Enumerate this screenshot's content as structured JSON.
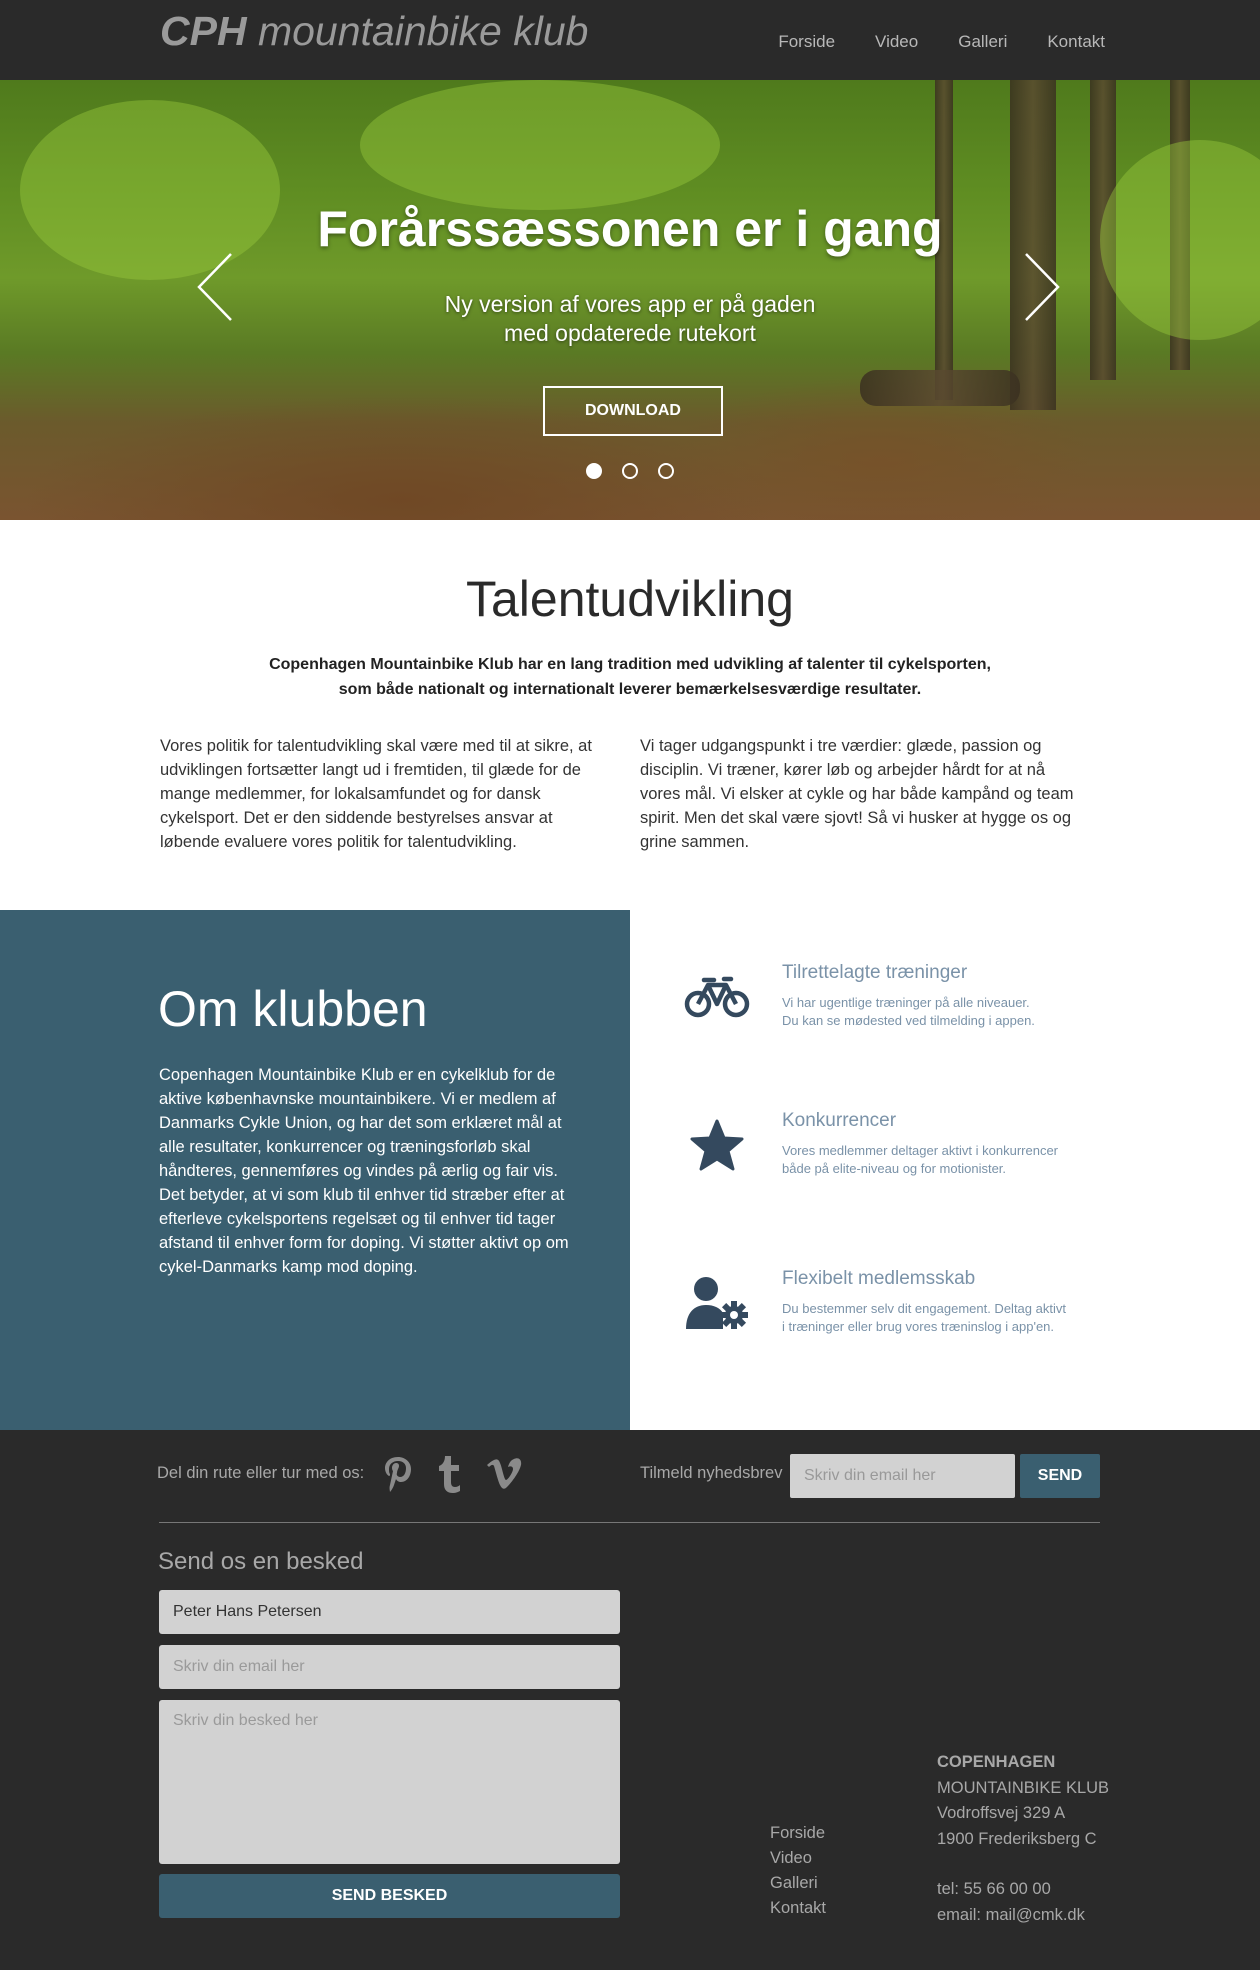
{
  "header": {
    "logo_bold": "CPH",
    "logo_rest": " mountainbike klub",
    "nav": [
      "Forside",
      "Video",
      "Galleri",
      "Kontakt"
    ]
  },
  "hero": {
    "title": "Forårssæssonen er i gang",
    "subtitle_line1": "Ny version af vores app er på gaden",
    "subtitle_line2": "med opdaterede rutekort",
    "button": "DOWNLOAD",
    "slides": 3,
    "active_slide": 1
  },
  "talent": {
    "title": "Talentudvikling",
    "lead_line1": "Copenhagen Mountainbike Klub har en lang tradition med udvikling af talenter til cykelsporten,",
    "lead_line2": "som både nationalt og internationalt leverer bemærkelsesværdige resultater.",
    "col1": "Vores politik for talentudvikling skal være med til at sikre, at udviklingen fortsætter langt ud i fremtiden, til glæde for de mange medlemmer, for lokalsamfundet og for dansk cykelsport. Det er den siddende bestyrelses ansvar at løbende evaluere vores politik for talentudvikling.",
    "col2": "Vi tager udgangspunkt i tre værdier: glæde, passion og disciplin. Vi træner, kører løb og arbejder hårdt for at nå vores mål.  Vi elsker at cykle og har både kampånd og team spirit. Men det skal være sjovt! Så vi husker at hygge os og grine sammen."
  },
  "about": {
    "title": "Om klubben",
    "text": "Copenhagen Mountainbike Klub er en cykelklub  for de aktive københavnske mountainbikere. Vi er medlem af Danmarks Cykle Union, og har det som erklæret mål at alle resultater, konkurrencer og træningsforløb skal håndteres, gennemføres og vindes på ærlig og fair vis. Det betyder, at vi som klub til enhver tid stræber efter at efterleve cykelsportens regelsæt og til enhver tid tager afstand til enhver form for doping. Vi støtter aktivt op om cykel-Danmarks kamp mod doping."
  },
  "features": [
    {
      "icon": "bicycle-icon",
      "title": "Tilrettelagte træninger",
      "line1": "Vi har ugentlige træninger på alle niveauer.",
      "line2": "Du kan se mødested ved tilmelding  i appen."
    },
    {
      "icon": "star-icon",
      "title": "Konkurrencer",
      "line1": "Vores medlemmer deltager aktivt i konkurrencer",
      "line2": "både på elite-niveau og for motionister."
    },
    {
      "icon": "user-gear-icon",
      "title": "Flexibelt medlemsskab",
      "line1": "Du bestemmer selv dit engagement. Deltag aktivt",
      "line2": "i træninger eller brug vores træninslog i app'en."
    }
  ],
  "footer": {
    "share_label": "Del din rute eller tur med os:",
    "social": [
      "pinterest-icon",
      "tumblr-icon",
      "vimeo-icon"
    ],
    "newsletter_label": "Tilmeld nyhedsbrev",
    "newsletter_placeholder": "Skriv din email her",
    "newsletter_button": "SEND",
    "message_title": "Send os en besked",
    "name_value": "Peter Hans Petersen",
    "email_placeholder": "Skriv din email her",
    "message_placeholder": "Skriv din besked her",
    "send_button": "SEND BESKED",
    "links": [
      "Forside",
      "Video",
      "Galleri",
      "Kontakt"
    ],
    "contact": {
      "name1": "COPENHAGEN",
      "name2": "MOUNTAINBIKE KLUB",
      "street": "Vodroffsvej 329 A",
      "city": "1900 Frederiksberg C",
      "tel": "tel: 55 66 00 00",
      "email": "email: mail@cmk.dk"
    }
  },
  "colors": {
    "accent": "#3a5f70",
    "dark": "#2a2a2a",
    "feature_text": "#7a92a8",
    "icon": "#34495e"
  }
}
